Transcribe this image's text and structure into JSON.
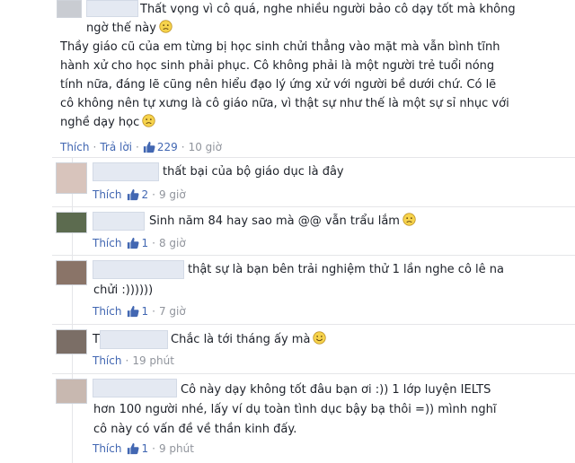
{
  "comments": [
    {
      "text_lines": [
        "Thất vọng vì cô quá, nghe nhiều người bảo cô dạy tốt mà không",
        "ngờ thế này",
        "Thầy giáo cũ của em từng bị học sinh chửi thẳng vào mặt mà vẫn bình tĩnh",
        "hành xử cho học sinh phải phục. Cô không phải là một người trẻ tuổi nóng",
        "tính nữa, đáng lẽ cũng nên hiểu đạo lý ứng xử với người bề dưới chứ. Có lẽ",
        "cô không nên tự xưng là cô giáo nữa, vì thật sự như thế là một sự sỉ nhục với",
        "nghề dạy học"
      ],
      "like_label": "Thích",
      "reply_label": "Trả lời",
      "likes": "229",
      "time": "10 giờ",
      "emoji": "frown-emoji"
    },
    {
      "text_lines": [
        "thất bại của bộ giáo dục là đây"
      ],
      "like_label": "Thích",
      "likes": "2",
      "time": "9 giờ"
    },
    {
      "text_lines": [
        "Sinh năm 84 hay sao mà @@ vẫn trẩu lắm"
      ],
      "like_label": "Thích",
      "likes": "1",
      "time": "8 giờ",
      "emoji": "frown-emoji"
    },
    {
      "text_lines": [
        "thật sự là bạn bên trải nghiệm thử 1 lần nghe cô lê na",
        "chửi :))))))"
      ],
      "like_label": "Thích",
      "likes": "1",
      "time": "7 giờ"
    },
    {
      "name_initial": "T",
      "text_lines": [
        "Chắc là tới tháng ấy mà"
      ],
      "like_label": "Thích",
      "time": "19 phút",
      "emoji": "smile-emoji"
    },
    {
      "text_lines": [
        "Cô này dạy không tốt đâu bạn ơi :)) 1 lớp luyện IELTS",
        "hơn 100 người nhé, lấy ví dụ toàn tình dục bậy bạ thôi =)) mình nghĩ",
        "cô này có vấn đề về thần kinh đấy."
      ],
      "like_label": "Thích",
      "likes": "1",
      "time": "9 phút"
    }
  ],
  "colors": {
    "link": "#4267b2",
    "meta": "#90949c",
    "text": "#1d2129"
  }
}
